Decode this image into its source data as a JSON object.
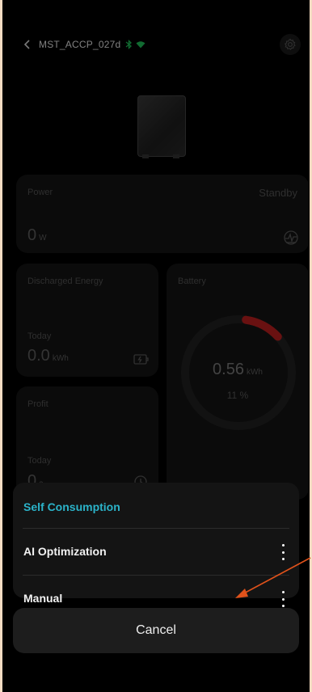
{
  "header": {
    "device_name": "MST_ACCP_027d",
    "back_icon": "chevron-left-icon",
    "status_icons": [
      "bluetooth-icon",
      "wifi-icon"
    ],
    "settings_icon": "gear-icon"
  },
  "power_card": {
    "label": "Power",
    "status": "Standby",
    "value": "0",
    "unit": "W",
    "icon": "power-chart-icon"
  },
  "discharged_card": {
    "label": "Discharged Energy",
    "period": "Today",
    "value": "0.0",
    "unit": "kWh",
    "icon": "battery-discharge-icon"
  },
  "battery_card": {
    "label": "Battery",
    "value": "0.56",
    "unit": "kWh",
    "percent": "11 %",
    "percent_value": 11,
    "accent_color": "#c0201f"
  },
  "profit_card": {
    "label": "Profit",
    "period": "Today",
    "value": "0",
    "unit": "a",
    "icon": "clock-icon"
  },
  "action_sheet": {
    "header": "Self Consumption",
    "accent_color": "#2bb3c9",
    "options": [
      {
        "label": "AI Optimization",
        "icon": "more-vertical-icon"
      },
      {
        "label": "Manual",
        "icon": "more-vertical-icon"
      }
    ],
    "cancel_label": "Cancel"
  },
  "annotation": {
    "color": "#e0521b",
    "icon": "arrow-annotation-icon"
  }
}
